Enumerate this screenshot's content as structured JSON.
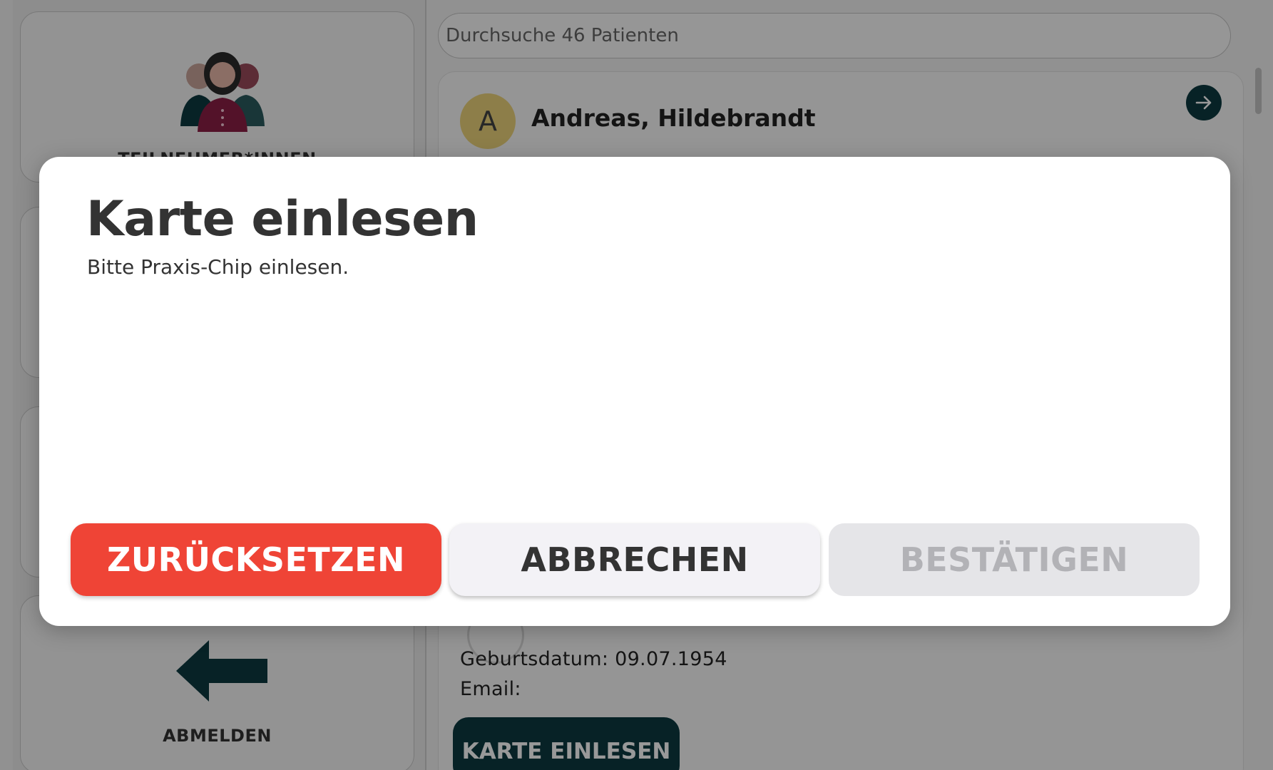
{
  "sidebar": {
    "participants_label": "TEILNEHMER*INNEN",
    "logout_label": "ABMELDEN"
  },
  "search": {
    "placeholder": "Durchsuche 46 Patienten"
  },
  "patient": {
    "avatar_letter": "A",
    "name": "Andreas, Hildebrandt",
    "birth_line": "Geburtsdatum: 09.07.1954",
    "email_line": "Email:",
    "read_card_button": "KARTE EINLESEN"
  },
  "dialog": {
    "title": "Karte einlesen",
    "message": "Bitte Praxis-Chip einlesen.",
    "reset_button": "ZURÜCKSETZEN",
    "cancel_button": "ABBRECHEN",
    "confirm_button": "BESTÄTIGEN"
  },
  "colors": {
    "primary_dark_teal": "#0d3a40",
    "reset_red": "#ef4436",
    "avatar_yellow": "#ecd27b"
  }
}
